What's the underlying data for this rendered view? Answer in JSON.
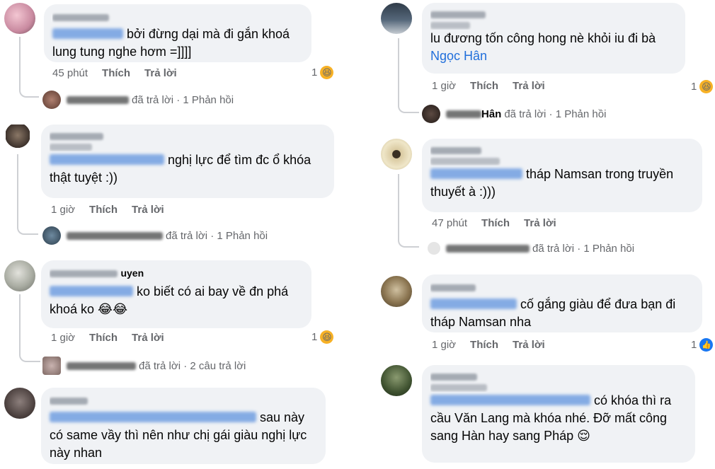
{
  "left": [
    {
      "text_after_mention": "bởi đừng dại mà đi gắn khoá lung tung nghe hơm =]]]]",
      "time": "45 phút",
      "like": "Thích",
      "reply": "Trả lời",
      "reaction_count": "1",
      "reaction": "haha",
      "replies_text": "đã trả lời · 1 Phản hồi"
    },
    {
      "text_after_mention": "nghị lực để tìm đc ổ khóa thật tuyệt :))",
      "time": "1 giờ",
      "like": "Thích",
      "reply": "Trả lời",
      "replies_text": "đã trả lời · 1 Phản hồi"
    },
    {
      "name_partial": "uyen",
      "text_after_mention": "ko biết có ai bay về đn phá khoá ko 😂😂",
      "time": "1 giờ",
      "like": "Thích",
      "reply": "Trả lời",
      "reaction_count": "1",
      "reaction": "haha",
      "replies_text": "đã trả lời · 2 câu trả lời"
    },
    {
      "text_after_mention": "sau này có same vầy thì nên như chị gái giàu nghị lực này nhan"
    }
  ],
  "right": [
    {
      "text": "lu đương tốn công hong nè khỏi iu đi bà",
      "mention": "Ngọc Hân",
      "time": "1 giờ",
      "like": "Thích",
      "reply": "Trả lời",
      "reaction_count": "1",
      "reaction": "haha",
      "replies_name_partial": "Hân",
      "replies_text": "đã trả lời · 1 Phản hồi"
    },
    {
      "text_after_mention": "tháp Namsan trong truyền thuyết à :)))",
      "time": "47 phút",
      "like": "Thích",
      "reply": "Trả lời",
      "replies_text": "đã trả lời · 1 Phản hồi"
    },
    {
      "text_after_mention": "cố gắng giàu để đưa bạn đi tháp Namsan nha",
      "time": "1 giờ",
      "like": "Thích",
      "reply": "Trả lời",
      "reaction_count": "1",
      "reaction": "like"
    },
    {
      "text_after_mention": "có khóa thì ra cầu Văn Lang mà khóa nhé. Đỡ mất công sang Hàn hay sang Pháp 😌"
    }
  ],
  "colors": {
    "bubble": "#f0f2f5",
    "link": "#216fdb",
    "meta": "#65676b",
    "haha": "#f7b125",
    "like": "#1877f2"
  }
}
